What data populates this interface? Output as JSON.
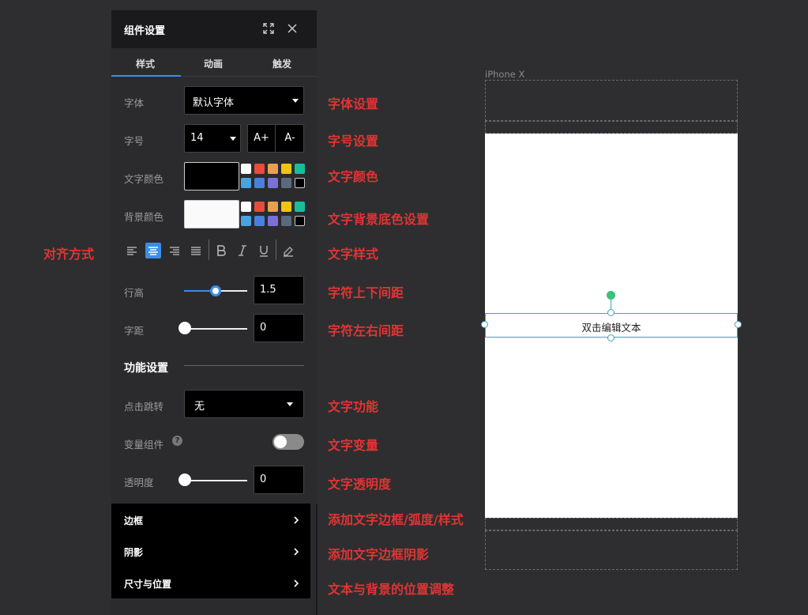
{
  "panel": {
    "title": "组件设置",
    "tabs": [
      "样式",
      "动画",
      "触发"
    ],
    "active_tab": "样式"
  },
  "style": {
    "font_label": "字体",
    "font_value": "默认字体",
    "size_label": "字号",
    "size_value": "14",
    "size_increase": "A+",
    "size_decrease": "A-",
    "text_color_label": "文字颜色",
    "bg_color_label": "背景颜色",
    "line_height_label": "行高",
    "line_height_value": "1.5",
    "letter_spacing_label": "字距",
    "letter_spacing_value": "0"
  },
  "text_color_swatches": [
    "#ffffff",
    "#e74c3c",
    "#e8a04c",
    "#f1c40f",
    "#1abc9c",
    "#4aa3df",
    "#4a7fe0",
    "#7b6fd8",
    "#5a6a7a",
    "#000000"
  ],
  "bg_color_swatches": [
    "#ffffff",
    "#e74c3c",
    "#e8a04c",
    "#f1c40f",
    "#1abc9c",
    "#4aa3df",
    "#4a7fe0",
    "#7b6fd8",
    "#5a6a7a",
    "#000000"
  ],
  "colors": {
    "accent": "#3a8ee6",
    "annotation": "#e03434",
    "text_color_value": "#000000",
    "bg_color_value": "#ffffff"
  },
  "function": {
    "section_title": "功能设置",
    "click_label": "点击跳转",
    "click_value": "无",
    "variable_label": "变量组件",
    "variable_enabled": false,
    "opacity_label": "透明度",
    "opacity_value": "0"
  },
  "collapsibles": [
    "边框",
    "阴影",
    "尺寸与位置"
  ],
  "annotations": {
    "font": "字体设置",
    "size": "字号设置",
    "text_color": "文字颜色",
    "bg_color": "文字背景底色设置",
    "align": "对齐方式",
    "text_style": "文字样式",
    "line_height": "字符上下间距",
    "letter_spacing": "字符左右间距",
    "click": "文字功能",
    "variable": "文字变量",
    "opacity": "文字透明度",
    "border": "添加文字边框/弧度/样式",
    "shadow": "添加文字边框阴影",
    "size_position": "文本与背景的位置调整"
  },
  "preview": {
    "device": "iPhone X",
    "text": "双击编辑文本"
  }
}
